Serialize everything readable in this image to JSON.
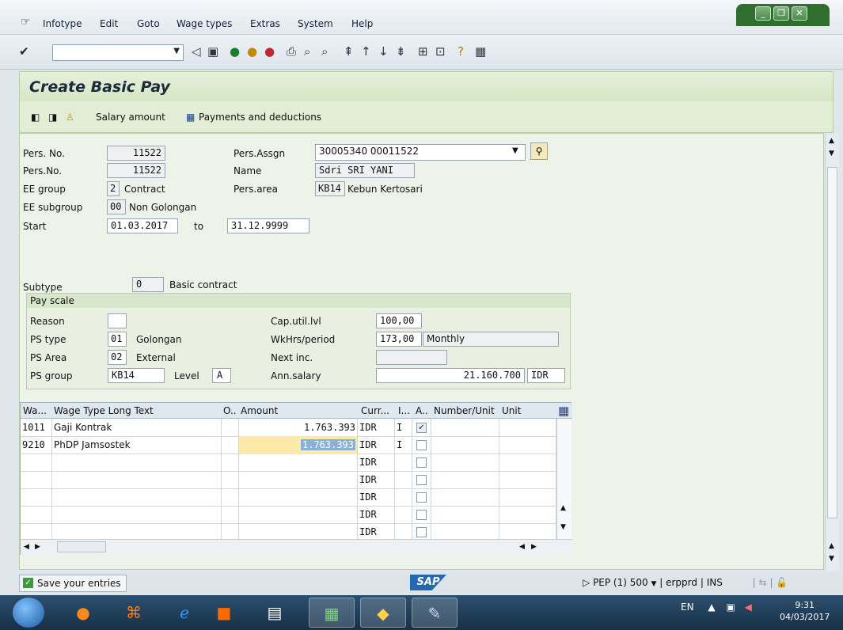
{
  "menubar": {
    "items": [
      "Infotype",
      "Edit",
      "Goto",
      "Wage types",
      "Extras",
      "System",
      "Help"
    ]
  },
  "toolbar": {
    "command_value": ""
  },
  "page": {
    "title": "Create Basic Pay"
  },
  "app_toolbar": {
    "salary_amount": "Salary amount",
    "payments": "Payments and deductions"
  },
  "header": {
    "pers_no_label": "Pers. No.",
    "pers_no": "11522",
    "pers_assgn_label": "Pers.Assgn",
    "pers_assgn": "30005340 00011522",
    "pers_no2_label": "Pers.No.",
    "pers_no2": "11522",
    "name_label": "Name",
    "name": "Sdri SRI YANI",
    "ee_group_label": "EE group",
    "ee_group": "2",
    "ee_group_text": "Contract",
    "pers_area_label": "Pers.area",
    "pers_area": "KB14",
    "pers_area_text": "Kebun Kertosari",
    "ee_subgroup_label": "EE subgroup",
    "ee_subgroup": "00",
    "ee_subgroup_text": "Non Golongan",
    "start_label": "Start",
    "start": "01.03.2017",
    "to_label": "to",
    "end": "31.12.9999"
  },
  "subtype": {
    "label": "Subtype",
    "value": "0",
    "text": "Basic contract"
  },
  "payscale": {
    "title": "Pay scale",
    "reason_label": "Reason",
    "reason": "",
    "ps_type_label": "PS type",
    "ps_type": "01",
    "ps_type_text": "Golongan",
    "ps_area_label": "PS Area",
    "ps_area": "02",
    "ps_area_text": "External",
    "ps_group_label": "PS group",
    "ps_group": "KB14",
    "level_label": "Level",
    "level": "A",
    "cap_util_label": "Cap.util.lvl",
    "cap_util": "100,00",
    "wkhrs_label": "WkHrs/period",
    "wkhrs": "173,00",
    "wkhrs_text": "Monthly",
    "next_inc_label": "Next inc.",
    "next_inc": "",
    "ann_salary_label": "Ann.salary",
    "ann_salary": "21.160.700",
    "ann_currency": "IDR"
  },
  "wage_table": {
    "headers": [
      "Wa...",
      "Wage Type Long Text",
      "O..",
      "Amount",
      "Curr...",
      "I...",
      "A..",
      "Number/Unit",
      "Unit"
    ],
    "rows": [
      {
        "wt": "1011",
        "text": "Gaji Kontrak",
        "amount": "1.763.393",
        "curr": "IDR",
        "ind": "I",
        "a": true
      },
      {
        "wt": "9210",
        "text": "PhDP Jamsostek",
        "amount": "1.763.393",
        "curr": "IDR",
        "ind": "I",
        "a": false
      },
      {
        "wt": "",
        "text": "",
        "amount": "",
        "curr": "IDR",
        "ind": "",
        "a": false
      },
      {
        "wt": "",
        "text": "",
        "amount": "",
        "curr": "IDR",
        "ind": "",
        "a": false
      },
      {
        "wt": "",
        "text": "",
        "amount": "",
        "curr": "IDR",
        "ind": "",
        "a": false
      },
      {
        "wt": "",
        "text": "",
        "amount": "",
        "curr": "IDR",
        "ind": "",
        "a": false
      },
      {
        "wt": "",
        "text": "",
        "amount": "",
        "curr": "IDR",
        "ind": "",
        "a": false
      }
    ]
  },
  "status": {
    "message": "Save your entries",
    "logo": "SAP",
    "system": "PEP (1) 500",
    "server": "erpprd",
    "mode": "INS"
  },
  "taskbar": {
    "lang": "EN",
    "time": "9:31",
    "date": "04/03/2017"
  },
  "colors": {
    "accent_green": "#d5e6c4",
    "title_text": "#1a2a3a",
    "taskbar": "#173047"
  }
}
